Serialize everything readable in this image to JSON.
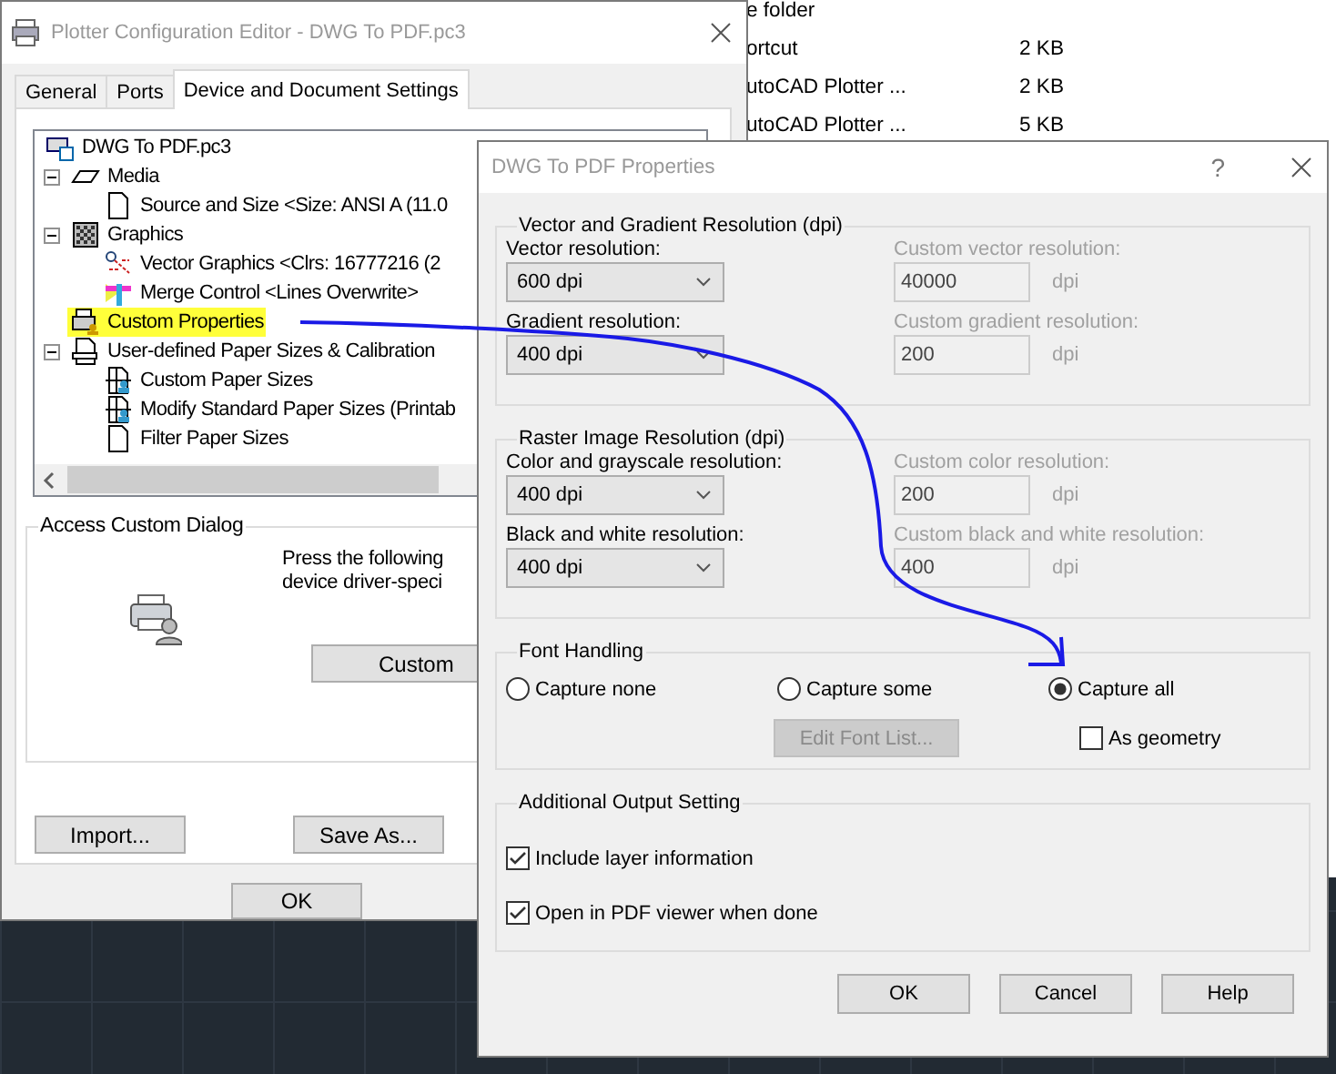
{
  "file_list": [
    {
      "name": "e folder"
    },
    {
      "name": "ortcut",
      "size": "2 KB"
    },
    {
      "name": "utoCAD Plotter ...",
      "size": "2 KB"
    },
    {
      "name": "utoCAD Plotter ...",
      "size": "5 KB"
    }
  ],
  "editor_window": {
    "title": "Plotter Configuration Editor - DWG To PDF.pc3",
    "tabs": [
      {
        "label": "General",
        "selected": false
      },
      {
        "label": "Ports",
        "selected": false
      },
      {
        "label": "Device and Document Settings",
        "selected": true
      }
    ],
    "tree": [
      {
        "label": "DWG To PDF.pc3",
        "kind": "device",
        "highlighted": false,
        "children": [
          {
            "label": "Media",
            "kind": "media",
            "expanded": true,
            "highlighted": false,
            "children": [
              {
                "label": "Source and Size <Size: ANSI A (11.0",
                "kind": "sheet",
                "highlighted": false
              }
            ]
          },
          {
            "label": "Graphics",
            "kind": "pattern",
            "expanded": true,
            "highlighted": false,
            "children": [
              {
                "label": "Vector Graphics <Clrs: 16777216 (2",
                "kind": "vector",
                "highlighted": false
              },
              {
                "label": "Merge Control <Lines Overwrite>",
                "kind": "merge",
                "highlighted": false
              }
            ]
          },
          {
            "label": "Custom Properties",
            "kind": "printer",
            "highlighted": true
          },
          {
            "label": "User-defined Paper Sizes & Calibration",
            "kind": "document",
            "expanded": true,
            "highlighted": false,
            "children": [
              {
                "label": "Custom Paper Sizes",
                "kind": "user-paper",
                "highlighted": false
              },
              {
                "label": "Modify Standard Paper Sizes (Printab",
                "kind": "user-paper",
                "highlighted": false
              },
              {
                "label": "Filter Paper Sizes",
                "kind": "sheet",
                "highlighted": false
              }
            ]
          }
        ]
      }
    ],
    "custom_dialog": {
      "title": "Access Custom Dialog",
      "text_lines": [
        "Press the following",
        "device driver-speci"
      ],
      "button": "Custom"
    },
    "panel_buttons": [
      "Import...",
      "Save As..."
    ],
    "footer_buttons": [
      "OK"
    ]
  },
  "properties_dialog": {
    "title": "DWG To PDF Properties",
    "help": "?",
    "resolution_groups": [
      {
        "title": "Vector and Gradient Resolution (dpi)",
        "rows": [
          {
            "label": "Vector resolution:",
            "value": "600 dpi",
            "custom": {
              "label": "Custom vector resolution:",
              "value": "40000",
              "unit": "dpi",
              "disabled": true
            }
          },
          {
            "label": "Gradient resolution:",
            "value": "400 dpi",
            "custom": {
              "label": "Custom gradient resolution:",
              "value": "200",
              "unit": "dpi",
              "disabled": true
            }
          }
        ]
      },
      {
        "title": "Raster Image Resolution (dpi)",
        "rows": [
          {
            "label": "Color and grayscale resolution:",
            "value": "400 dpi",
            "custom": {
              "label": "Custom color resolution:",
              "value": "200",
              "unit": "dpi",
              "disabled": true
            }
          },
          {
            "label": "Black and white resolution:",
            "value": "400 dpi",
            "custom": {
              "label": "Custom black and white resolution:",
              "value": "400",
              "unit": "dpi",
              "disabled": true
            }
          }
        ]
      }
    ],
    "font_handling": {
      "title": "Font Handling",
      "options": [
        {
          "label": "Capture none",
          "selected": false
        },
        {
          "label": "Capture some",
          "selected": false
        },
        {
          "label": "Capture all",
          "selected": true
        }
      ],
      "edit_button": {
        "label": "Edit Font List...",
        "disabled": true
      },
      "as_geometry": {
        "label": "As geometry",
        "checked": false
      }
    },
    "additional_output": {
      "title": "Additional Output Setting",
      "checkboxes": [
        {
          "label": "Include layer information",
          "checked": true
        },
        {
          "label": "Open in PDF viewer when done",
          "checked": true
        }
      ]
    },
    "buttons": [
      "OK",
      "Cancel",
      "Help"
    ]
  }
}
